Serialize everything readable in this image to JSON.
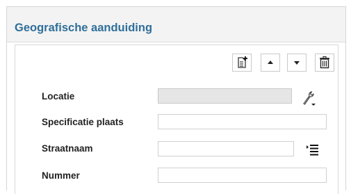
{
  "panel": {
    "title": "Geografische aanduiding"
  },
  "toolbar": {
    "buttons": [
      {
        "icon": "add-document-icon"
      },
      {
        "icon": "arrow-up-icon"
      },
      {
        "icon": "arrow-down-icon"
      },
      {
        "icon": "trash-icon"
      }
    ]
  },
  "form": {
    "locatie": {
      "label": "Locatie",
      "value": "",
      "icon": "wrench-icon"
    },
    "specificatie": {
      "label": "Specificatie plaats",
      "value": ""
    },
    "straatnaam": {
      "label": "Straatnaam",
      "value": "",
      "icon": "list-icon"
    },
    "nummer": {
      "label": "Nummer",
      "value": ""
    }
  },
  "colors": {
    "title": "#2f6f9a",
    "header_bg": "#f3f3f3",
    "disabled_field": "#e6e6e6"
  }
}
